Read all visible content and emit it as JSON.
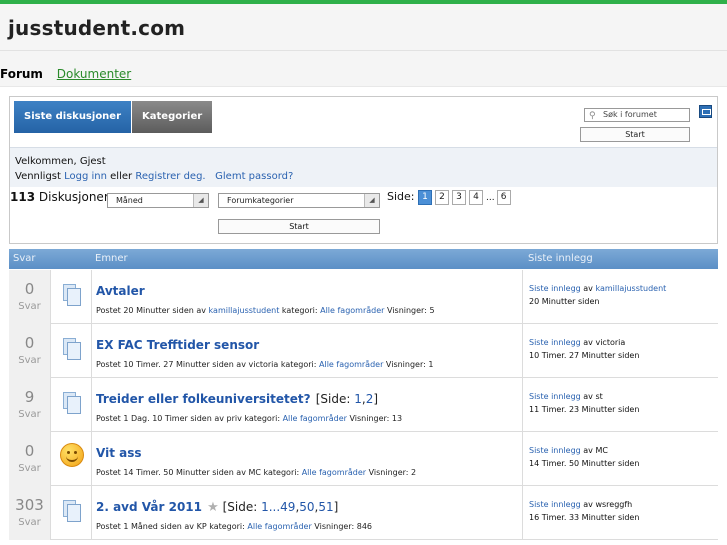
{
  "site": {
    "title": "jusstudent.com"
  },
  "nav": {
    "forum": "Forum",
    "documents": "Dokumenter"
  },
  "tabs": [
    {
      "label": "Siste diskusjoner",
      "active": true
    },
    {
      "label": "Kategorier",
      "active": false
    }
  ],
  "search": {
    "placeholder": "Søk i forumet",
    "button": "Start"
  },
  "welcome": {
    "greeting": "Velkommen, Gjest",
    "prefix": "Vennligst",
    "login": "Logg inn",
    "or": "eller",
    "register": "Registrer deg.",
    "forgot": "Glemt passord?"
  },
  "filters": {
    "count": "113",
    "count_label": "Diskusjoner",
    "period": "Måned",
    "category": "Forumkategorier",
    "page_label": "Side:",
    "pages": [
      "1",
      "2",
      "3",
      "4",
      "...",
      "6"
    ],
    "start": "Start"
  },
  "table": {
    "headers": {
      "replies": "Svar",
      "topics": "Emner",
      "last": "Siste innlegg"
    },
    "reply_label": "Svar",
    "rows": [
      {
        "replies": "0",
        "icon": "document-icon",
        "title": "Avtaler",
        "pages": null,
        "meta_prefix": "Postet 20 Minutter siden av",
        "author": "kamillajusstudent",
        "meta_category_label": "kategori:",
        "category": "Alle fagområder",
        "views": "Visninger: 5",
        "last_link": "Siste innlegg",
        "last_by": "av",
        "last_user": "kamillajusstudent",
        "last_time": "20 Minutter siden"
      },
      {
        "replies": "0",
        "icon": "document-icon",
        "title": "EX FAC Trefftider sensor",
        "pages": null,
        "meta_prefix": "Postet 10 Timer. 27 Minutter siden av victoria",
        "author": "",
        "meta_category_label": "kategori:",
        "category": "Alle fagområder",
        "views": "Visninger: 1",
        "last_link": "Siste innlegg",
        "last_by": "av victoria",
        "last_user": "",
        "last_time": "10 Timer. 27 Minutter siden"
      },
      {
        "replies": "9",
        "icon": "document-icon",
        "title": "Treider eller folkeuniversitetet?",
        "pages": {
          "prefix": "[Side: ",
          "links": [
            "1",
            "2"
          ],
          "suffix": "]"
        },
        "meta_prefix": "Postet 1 Dag. 10 Timer siden av priv",
        "author": "",
        "meta_category_label": "kategori:",
        "category": "Alle fagområder",
        "views": "Visninger: 13",
        "last_link": "Siste innlegg",
        "last_by": "av st",
        "last_user": "",
        "last_time": "11 Timer. 23 Minutter siden"
      },
      {
        "replies": "0",
        "icon": "smiley-icon",
        "title": "Vit ass",
        "pages": null,
        "meta_prefix": "Postet 14 Timer. 50 Minutter siden av MC",
        "author": "",
        "meta_category_label": "kategori:",
        "category": "Alle fagområder",
        "views": "Visninger: 2",
        "last_link": "Siste innlegg",
        "last_by": "av MC",
        "last_user": "",
        "last_time": "14 Timer. 50 Minutter siden"
      },
      {
        "replies": "303",
        "icon": "document-icon",
        "title": "2. avd Vår 2011",
        "pages": {
          "prefix": "[Side: ",
          "links": [
            "1...49",
            "50",
            "51"
          ],
          "suffix": "]"
        },
        "star": true,
        "meta_prefix": "Postet 1 Måned siden av KP",
        "author": "",
        "meta_category_label": "kategori:",
        "category": "Alle fagområder",
        "views": "Visninger: 846",
        "last_link": "Siste innlegg",
        "last_by": "av wsreggfh",
        "last_user": "",
        "last_time": "16 Timer. 33 Minutter siden"
      }
    ]
  }
}
